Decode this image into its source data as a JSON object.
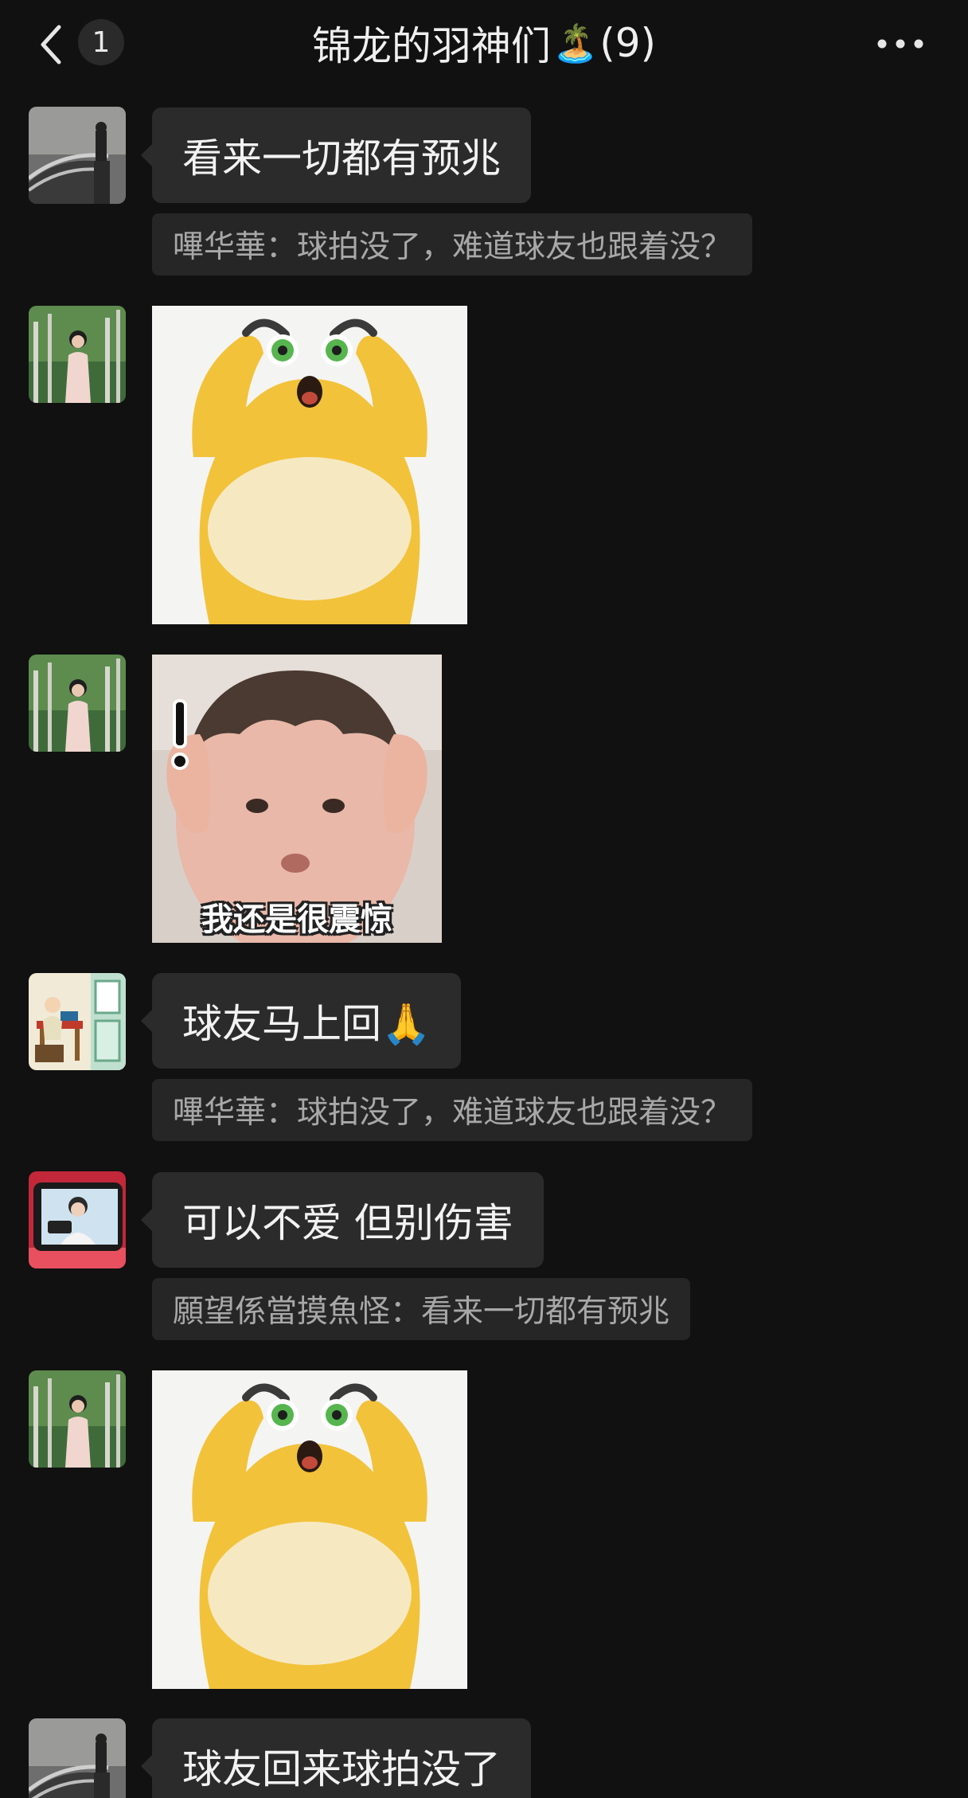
{
  "header": {
    "back_icon": "chevron-left-icon",
    "unread_count": "1",
    "title_text": "锦龙的羽神们",
    "title_emoji": "🏝️",
    "member_count": "(9)",
    "more_icon": "more-horizontal-icon"
  },
  "messages": [
    {
      "type": "text",
      "text": "看来一切都有预兆",
      "quote": "嗶华華：球拍没了，难道球友也跟着没？",
      "avatar": "avatar-gray-photo"
    },
    {
      "type": "sticker",
      "sticker": "yellow-creature-shocked",
      "avatar": "avatar-green-woman"
    },
    {
      "type": "sticker",
      "sticker": "baby-shocked",
      "caption": "我还是很震惊",
      "avatar": "avatar-green-woman"
    },
    {
      "type": "text",
      "text": "球友马上回🙏",
      "quote": "嗶华華：球拍没了，难道球友也跟着没？",
      "avatar": "avatar-cartoon-scene"
    },
    {
      "type": "text",
      "text": "可以不爱 但别伤害",
      "quote": "願望係當摸魚怪：看来一切都有预兆",
      "avatar": "avatar-red-phone"
    },
    {
      "type": "sticker",
      "sticker": "yellow-creature-shocked",
      "avatar": "avatar-green-woman"
    },
    {
      "type": "text",
      "text": "球友回来球拍没了",
      "avatar": "avatar-gray-photo"
    }
  ],
  "colors": {
    "background": "#111111",
    "bubble": "#2b2b2b",
    "quote_bg": "#262626",
    "quote_text": "#a8a8a8",
    "sticker_yellow": "#f2c23a"
  }
}
